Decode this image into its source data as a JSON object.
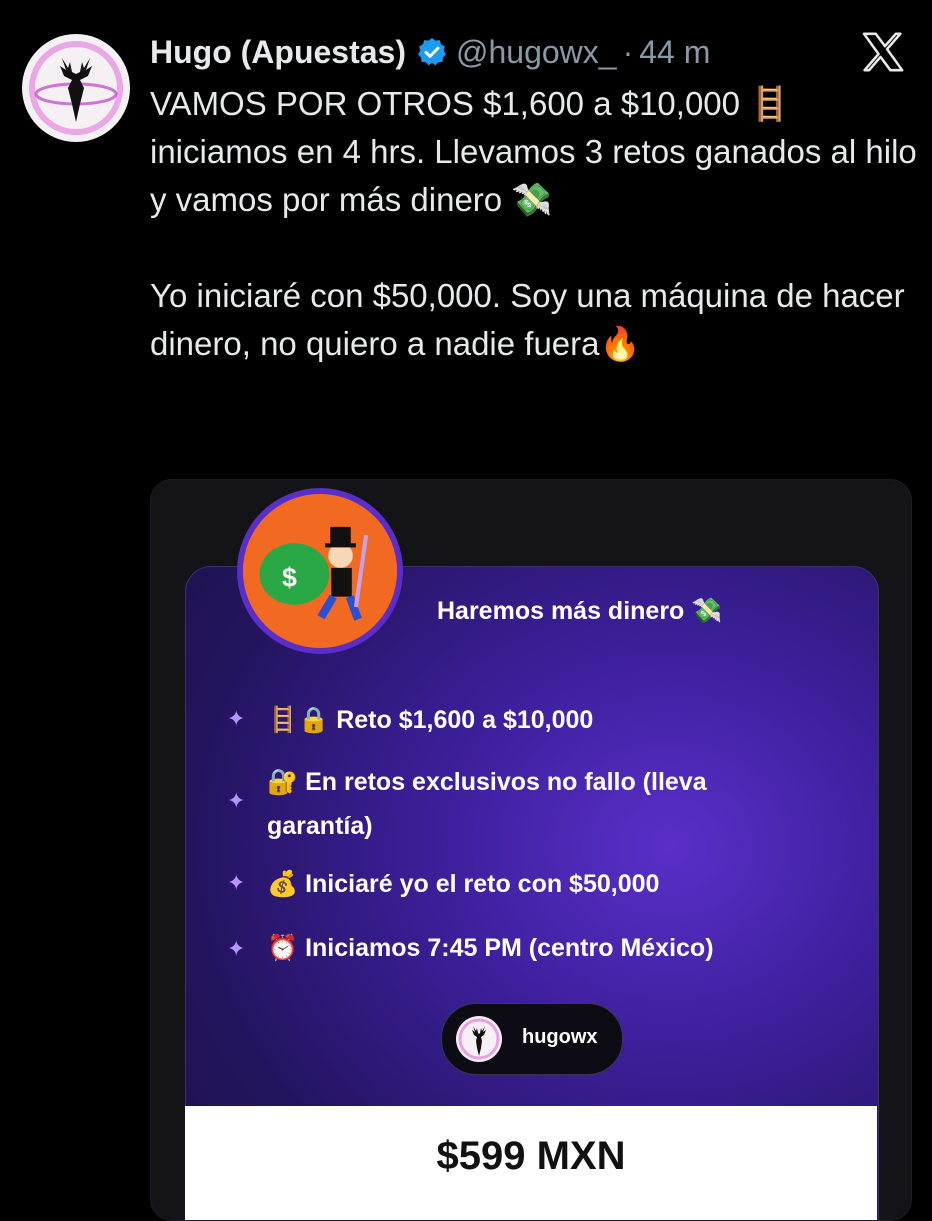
{
  "author": {
    "name": "Hugo (Apuestas)",
    "handle": "@hugowx_",
    "time": "44 m",
    "verified": true,
    "avatar_icon": "deer-head-icon"
  },
  "platform_icon": "x-logo-icon",
  "tweet": {
    "paragraph1": "VAMOS POR OTROS $1,600 a $10,000 🪜 iniciamos en 4 hrs. Llevamos 3 retos ganados al hilo y vamos por más dinero 💸",
    "paragraph2": "Yo iniciaré con $50,000. Soy una máquina de hacer dinero, no quiero a nadie fuera🔥"
  },
  "card": {
    "title": "Haremos más dinero 💸",
    "features": [
      "🪜🔒 Reto $1,600 a $10,000",
      "🔐 En retos exclusivos no fallo (lleva garantía)",
      "💰 Iniciaré yo el reto con $50,000",
      "⏰ Iniciamos 7:45 PM (centro México)"
    ],
    "chip_name": "hugowx",
    "price": "$599 MXN"
  },
  "colors": {
    "background": "#000000",
    "text": "#e7e9ea",
    "muted": "#8b98a5",
    "verified": "#1d9bf0",
    "card_purple": "#3b1f99",
    "sparkle": "#b595ff"
  }
}
